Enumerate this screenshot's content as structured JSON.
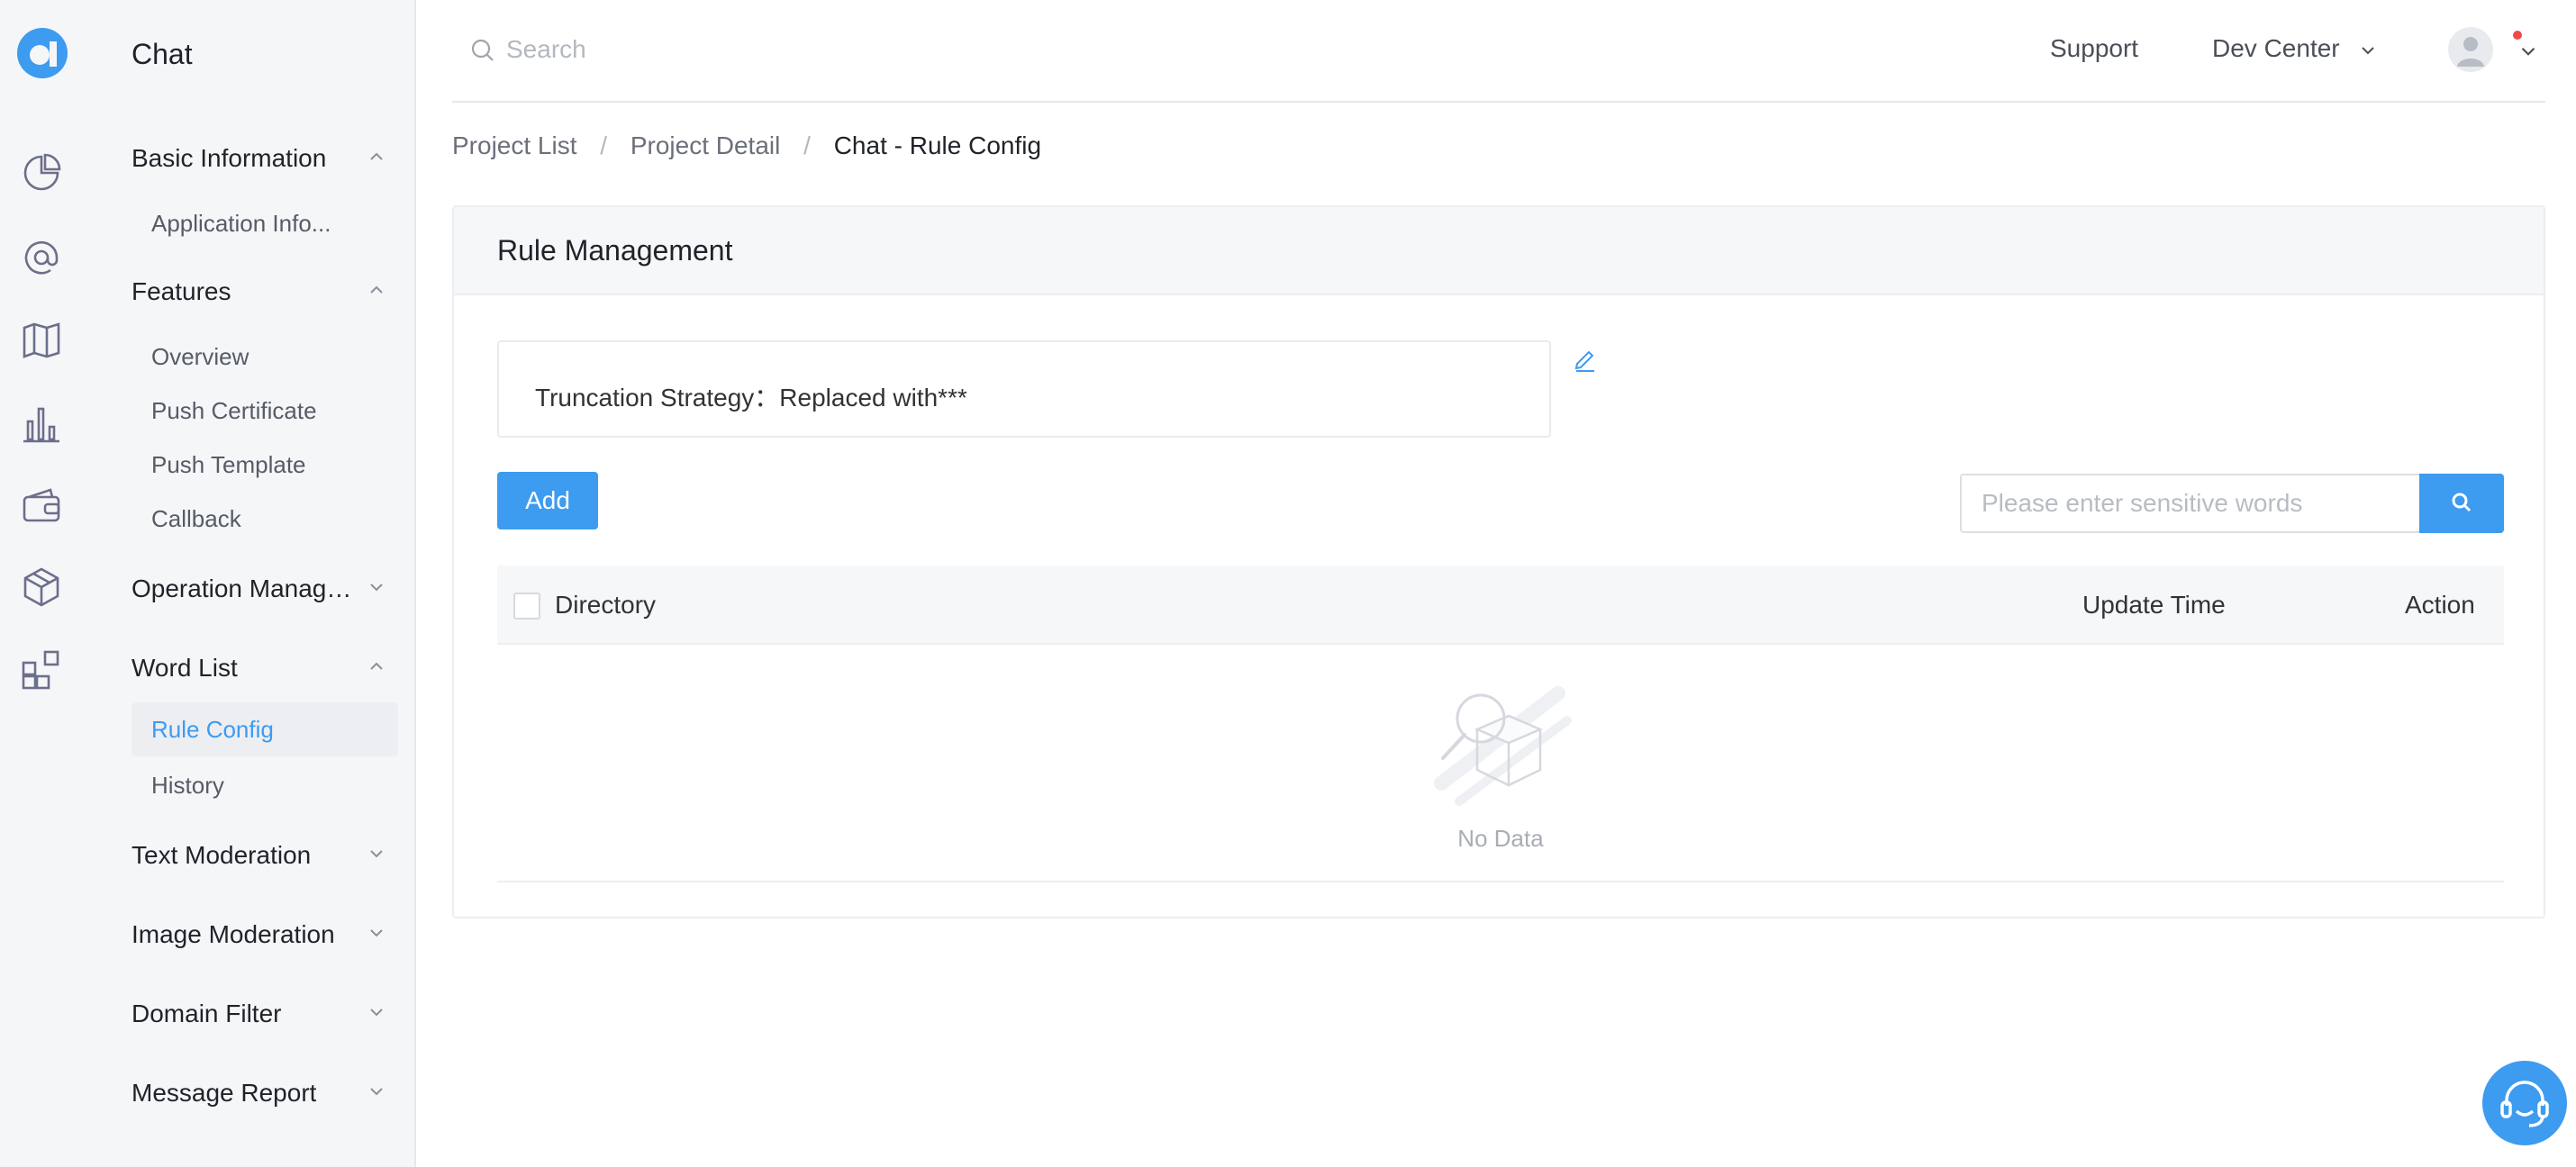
{
  "app": {
    "section_title": "Chat"
  },
  "colors": {
    "accent": "#3d9bf0",
    "notification": "#f04a4a"
  },
  "rail": {
    "logo": "brand-logo-icon",
    "icons": [
      "pie-chart-icon",
      "at-sign-icon",
      "map-icon",
      "bar-chart-icon",
      "wallet-icon",
      "package-icon",
      "apps-icon"
    ]
  },
  "sidebar": {
    "groups": [
      {
        "label": "Basic Information",
        "expanded": true,
        "items": [
          "Application Info..."
        ]
      },
      {
        "label": "Features",
        "expanded": true,
        "items": [
          "Overview",
          "Push Certificate",
          "Push Template",
          "Callback"
        ]
      },
      {
        "label": "Operation Management",
        "expanded": false,
        "items": []
      },
      {
        "label": "Word List",
        "expanded": true,
        "items": [
          "Rule Config",
          "History"
        ],
        "active_item": "Rule Config"
      },
      {
        "label": "Text Moderation",
        "expanded": false,
        "items": []
      },
      {
        "label": "Image Moderation",
        "expanded": false,
        "items": []
      },
      {
        "label": "Domain Filter",
        "expanded": false,
        "items": []
      },
      {
        "label": "Message Report",
        "expanded": false,
        "items": []
      }
    ]
  },
  "topbar": {
    "search_placeholder": "Search",
    "support_label": "Support",
    "dev_center_label": "Dev Center"
  },
  "breadcrumb": {
    "items": [
      "Project List",
      "Project Detail"
    ],
    "current": "Chat - Rule Config",
    "separator": "/"
  },
  "card": {
    "title": "Rule Management",
    "strategy_text": "Truncation Strategy：Replaced with***",
    "add_label": "Add",
    "search_placeholder": "Please enter sensitive words",
    "table": {
      "columns": [
        "Directory",
        "Update Time",
        "Action"
      ],
      "rows": [],
      "empty_text": "No Data"
    }
  }
}
